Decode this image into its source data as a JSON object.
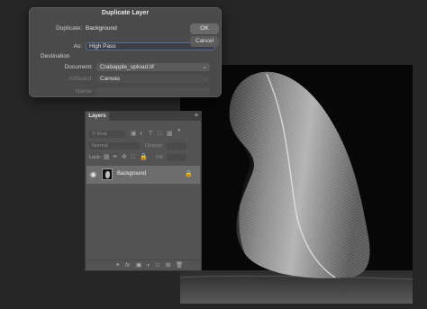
{
  "dialog": {
    "title": "Duplicate Layer",
    "duplicate_label": "Duplicate:",
    "duplicate_value": "Background",
    "as_label": "As:",
    "as_value": "High Pass",
    "destination_label": "Destination",
    "document_label": "Document:",
    "document_value": "Crabapple_upload.tif",
    "artboard_label": "Artboard:",
    "artboard_value": "Canvas",
    "name_label": "Name:",
    "ok_label": "OK",
    "cancel_label": "Cancel"
  },
  "layers": {
    "tab_label": "Layers",
    "search_placeholder": "Kind",
    "blend_mode": "Normal",
    "opacity_label": "Opacity:",
    "lock_label": "Lock:",
    "fill_label": "Fill:",
    "layer_name": "Background",
    "footer_icons": [
      "link-icon",
      "fx-icon",
      "mask-icon",
      "adjustment-icon",
      "group-icon",
      "new-layer-icon",
      "trash-icon"
    ]
  },
  "colors": {
    "app_background": "#262626",
    "panel": "#535353",
    "dialog": "#4a4a4a",
    "selected_row": "#6d6d6d"
  }
}
